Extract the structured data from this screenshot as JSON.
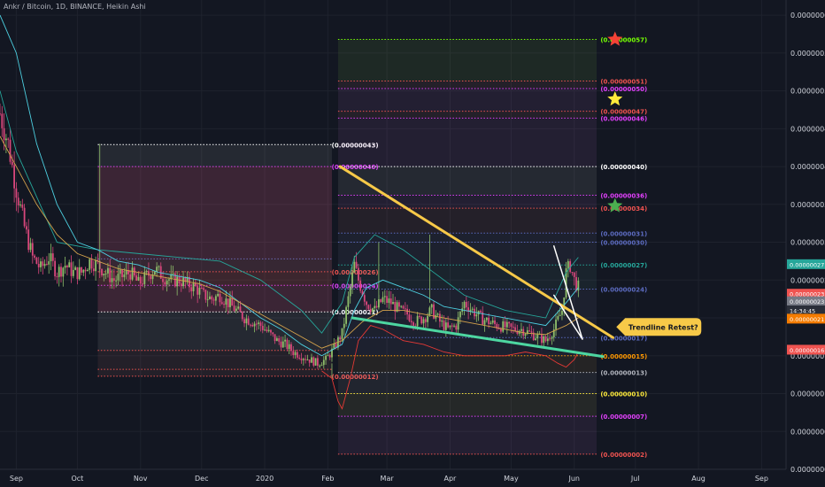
{
  "chart_data": {
    "type": "candlestick",
    "title": "Ankr / Bitcoin, 1D, BINANCE, Heikin Ashi",
    "x_ticks": [
      "Sep",
      "Oct",
      "Nov",
      "Dec",
      "2020",
      "Feb",
      "Mar",
      "Apr",
      "May",
      "Jun",
      "Jul",
      "Aug",
      "Sep"
    ],
    "y_ticks": [
      "0.00000060",
      "0.00000055",
      "0.00000050",
      "0.00000045",
      "0.00000040",
      "0.00000035",
      "0.00000030",
      "0.00000025",
      "0.00000020",
      "0.00000015",
      "0.00000010",
      "0.00000005",
      "0.00000000"
    ],
    "y_tick_values": [
      60,
      55,
      50,
      45,
      40,
      35,
      30,
      25,
      20,
      15,
      10,
      5,
      0
    ],
    "ylim": [
      0,
      62
    ],
    "x_tick_days": [
      0,
      30,
      61,
      91,
      122,
      153,
      182,
      213,
      243,
      274,
      304,
      335,
      366
    ],
    "xlim": [
      -8,
      378
    ],
    "price_tags": [
      {
        "label": "0.00000027",
        "value": 27.1,
        "color": "#26a69a"
      },
      {
        "label": "0.00000023",
        "value": 23.2,
        "color": "#ef5350"
      },
      {
        "label": "0.00000023",
        "value": 22.2,
        "color": "#787b86"
      },
      {
        "label": "14:34:45",
        "value": 21.0,
        "color": "#2a2e39"
      },
      {
        "label": "0.00000021",
        "value": 19.9,
        "color": "#f57c00"
      },
      {
        "label": "0.00000016",
        "value": 15.8,
        "color": "#ef5350"
      }
    ],
    "fib_left": {
      "day_start": 40,
      "day_end": 155,
      "label_day": 154,
      "levels": [
        {
          "label": "(0.00000043)",
          "value": 42.9,
          "color": "#ffffff",
          "show": true
        },
        {
          "label": "(0.00000040)",
          "value": 40.0,
          "color": "#e040fb",
          "show": true
        },
        {
          "label": "(0.00000028)",
          "value": 27.8,
          "color": "#5c6bc0",
          "show": false
        },
        {
          "label": "(0.00000026)",
          "value": 26.1,
          "color": "#ef5350",
          "show": true
        },
        {
          "label": "(0.00000024)",
          "value": 24.3,
          "color": "#e040fb",
          "show": true
        },
        {
          "label": "(0.00000021)",
          "value": 20.8,
          "color": "#ffffff",
          "show": true
        },
        {
          "label": "(0.00000015)",
          "value": 15.7,
          "color": "#ef5350",
          "show": false
        },
        {
          "label": "(0.00000013)",
          "value": 13.2,
          "color": "#ef5350",
          "show": false
        },
        {
          "label": "(0.00000012)",
          "value": 12.3,
          "color": "#ef5350",
          "show": true
        }
      ]
    },
    "fib_right": {
      "day_start": 158,
      "day_end": 285,
      "label_day": 286,
      "levels": [
        {
          "label": "(0.00000057)",
          "value": 56.8,
          "color": "#76ff03",
          "show": true
        },
        {
          "label": "(0.00000051)",
          "value": 51.3,
          "color": "#ef5350",
          "show": true
        },
        {
          "label": "(0.00000050)",
          "value": 50.3,
          "color": "#e040fb",
          "show": true
        },
        {
          "label": "(0.00000047)",
          "value": 47.3,
          "color": "#ef5350",
          "show": true
        },
        {
          "label": "(0.00000046)",
          "value": 46.4,
          "color": "#e040fb",
          "show": true
        },
        {
          "label": "(0.00000040)",
          "value": 40.0,
          "color": "#ffffff",
          "show": true
        },
        {
          "label": "(0.00000036)",
          "value": 36.2,
          "color": "#e040fb",
          "show": true
        },
        {
          "label": "(0.00000034)",
          "value": 34.5,
          "color": "#ef5350",
          "show": true
        },
        {
          "label": "(0.00000031)",
          "value": 31.2,
          "color": "#5c6bc0",
          "show": true
        },
        {
          "label": "(0.00000030)",
          "value": 30.0,
          "color": "#5c6bc0",
          "show": true
        },
        {
          "label": "(0.00000027)",
          "value": 27.0,
          "color": "#26a69a",
          "show": true
        },
        {
          "label": "(0.00000024)",
          "value": 23.8,
          "color": "#5c6bc0",
          "show": true
        },
        {
          "label": "(0.00000017)",
          "value": 17.4,
          "color": "#5c6bc0",
          "show": true
        },
        {
          "label": "(0.00000015)",
          "value": 15.0,
          "color": "#ff9800",
          "show": true
        },
        {
          "label": "(0.00000013)",
          "value": 12.8,
          "color": "#b2b5be",
          "show": true
        },
        {
          "label": "(0.00000010)",
          "value": 10.0,
          "color": "#ffeb3b",
          "show": true
        },
        {
          "label": "(0.00000007)",
          "value": 7.0,
          "color": "#e040fb",
          "show": true
        },
        {
          "label": "(0.00000002)",
          "value": 2.0,
          "color": "#ef5350",
          "show": true
        }
      ]
    },
    "trendlines": [
      {
        "name": "descending-resistance",
        "color": "#f7c948",
        "x1": 159,
        "y1": 40.0,
        "x2": 293,
        "y2": 17.4
      },
      {
        "name": "ascending-support",
        "color": "#4dd6a1",
        "x1": 165,
        "y1": 20.0,
        "x2": 288,
        "y2": 14.9
      },
      {
        "name": "wedge-upper",
        "color": "#ffffff",
        "x1": 264,
        "y1": 29.5,
        "x2": 278,
        "y2": 17.2
      },
      {
        "name": "wedge-lower",
        "color": "#ffffff",
        "x1": 264,
        "y1": 23.0,
        "x2": 278,
        "y2": 17.2
      }
    ],
    "stars": [
      {
        "name": "red-star",
        "color": "#f44336",
        "day": 294,
        "value": 56.8
      },
      {
        "name": "yellow-star",
        "color": "#ffeb3b",
        "day": 294,
        "value": 48.9
      },
      {
        "name": "green-star",
        "color": "#4caf50",
        "day": 294,
        "value": 34.8
      }
    ],
    "callout": {
      "text": "Trendline Retest?",
      "day": 299,
      "value": 18.8
    },
    "keypoints": [
      [
        -8,
        47
      ],
      [
        -4,
        43
      ],
      [
        0,
        37
      ],
      [
        4,
        32
      ],
      [
        8,
        28
      ],
      [
        12,
        26.5
      ],
      [
        16,
        28
      ],
      [
        20,
        26
      ],
      [
        24,
        27
      ],
      [
        28,
        26
      ],
      [
        32,
        26
      ],
      [
        36,
        27.5
      ],
      [
        40,
        27
      ],
      [
        44,
        26
      ],
      [
        48,
        25
      ],
      [
        52,
        25.5
      ],
      [
        56,
        26
      ],
      [
        60,
        24.5
      ],
      [
        64,
        25.5
      ],
      [
        68,
        26.5
      ],
      [
        72,
        25.5
      ],
      [
        76,
        25
      ],
      [
        80,
        25
      ],
      [
        84,
        24.5
      ],
      [
        88,
        24
      ],
      [
        92,
        23
      ],
      [
        96,
        22.5
      ],
      [
        100,
        23
      ],
      [
        104,
        22
      ],
      [
        108,
        21
      ],
      [
        112,
        20
      ],
      [
        116,
        19.5
      ],
      [
        120,
        19
      ],
      [
        124,
        18
      ],
      [
        128,
        17
      ],
      [
        132,
        16.5
      ],
      [
        136,
        15.5
      ],
      [
        140,
        15
      ],
      [
        144,
        14.5
      ],
      [
        148,
        14
      ],
      [
        152,
        14.5
      ],
      [
        156,
        16
      ],
      [
        160,
        18
      ],
      [
        164,
        24
      ],
      [
        166,
        27
      ],
      [
        168,
        25
      ],
      [
        172,
        22
      ],
      [
        176,
        21
      ],
      [
        180,
        22.5
      ],
      [
        184,
        22
      ],
      [
        188,
        21
      ],
      [
        192,
        20.5
      ],
      [
        196,
        19.5
      ],
      [
        200,
        20
      ],
      [
        204,
        21
      ],
      [
        208,
        19.5
      ],
      [
        212,
        18.5
      ],
      [
        216,
        19
      ],
      [
        220,
        22
      ],
      [
        224,
        21
      ],
      [
        228,
        20
      ],
      [
        232,
        19.5
      ],
      [
        236,
        19
      ],
      [
        240,
        18.8
      ],
      [
        244,
        18.5
      ],
      [
        248,
        18.5
      ],
      [
        252,
        18
      ],
      [
        256,
        17.5
      ],
      [
        260,
        17
      ],
      [
        264,
        18.5
      ],
      [
        268,
        21
      ],
      [
        270,
        26
      ],
      [
        272,
        27
      ],
      [
        274,
        25
      ],
      [
        276,
        24
      ]
    ],
    "ma_teal": [
      [
        -8,
        60
      ],
      [
        0,
        55
      ],
      [
        10,
        43
      ],
      [
        20,
        35
      ],
      [
        30,
        30
      ],
      [
        40,
        29
      ],
      [
        50,
        27.5
      ],
      [
        60,
        27
      ],
      [
        70,
        26
      ],
      [
        80,
        25.5
      ],
      [
        90,
        25
      ],
      [
        100,
        24
      ],
      [
        110,
        22
      ],
      [
        120,
        20
      ],
      [
        130,
        18.5
      ],
      [
        140,
        16.5
      ],
      [
        150,
        15
      ],
      [
        160,
        16.5
      ],
      [
        166,
        21
      ],
      [
        172,
        24
      ],
      [
        180,
        25
      ],
      [
        190,
        24
      ],
      [
        200,
        23
      ],
      [
        210,
        21.5
      ],
      [
        220,
        21
      ],
      [
        230,
        20.5
      ],
      [
        240,
        20
      ],
      [
        250,
        19.5
      ],
      [
        260,
        19
      ],
      [
        270,
        22
      ],
      [
        276,
        24
      ]
    ],
    "ma_orange": [
      [
        -8,
        44
      ],
      [
        0,
        40
      ],
      [
        10,
        35
      ],
      [
        20,
        31
      ],
      [
        30,
        28.5
      ],
      [
        40,
        27.5
      ],
      [
        50,
        26.5
      ],
      [
        60,
        26
      ],
      [
        70,
        25.5
      ],
      [
        80,
        25
      ],
      [
        90,
        24.5
      ],
      [
        100,
        23.5
      ],
      [
        110,
        22
      ],
      [
        120,
        20.5
      ],
      [
        130,
        19
      ],
      [
        140,
        17.5
      ],
      [
        150,
        16
      ],
      [
        160,
        17
      ],
      [
        170,
        19.5
      ],
      [
        180,
        21
      ],
      [
        190,
        21
      ],
      [
        200,
        20.5
      ],
      [
        210,
        20
      ],
      [
        220,
        19.5
      ],
      [
        230,
        19
      ],
      [
        240,
        18.5
      ],
      [
        250,
        18
      ],
      [
        260,
        17.8
      ],
      [
        270,
        19
      ],
      [
        276,
        20
      ]
    ],
    "bb_lower_red": [
      [
        150,
        13
      ],
      [
        155,
        12
      ],
      [
        158,
        9
      ],
      [
        160,
        8
      ],
      [
        164,
        12
      ],
      [
        168,
        17
      ],
      [
        174,
        19
      ],
      [
        180,
        18.5
      ],
      [
        190,
        17
      ],
      [
        200,
        16.5
      ],
      [
        210,
        15.5
      ],
      [
        220,
        15
      ],
      [
        230,
        15
      ],
      [
        240,
        15
      ],
      [
        250,
        15.5
      ],
      [
        260,
        15
      ],
      [
        266,
        14
      ],
      [
        270,
        13.5
      ],
      [
        274,
        14.5
      ],
      [
        276,
        15.5
      ]
    ],
    "bb_upper_teal2": [
      [
        -8,
        50
      ],
      [
        0,
        42
      ],
      [
        20,
        30
      ],
      [
        40,
        29
      ],
      [
        60,
        28.5
      ],
      [
        80,
        28
      ],
      [
        100,
        27.5
      ],
      [
        120,
        25
      ],
      [
        140,
        21
      ],
      [
        150,
        18
      ],
      [
        160,
        22
      ],
      [
        166,
        28
      ],
      [
        176,
        31
      ],
      [
        190,
        29
      ],
      [
        200,
        27
      ],
      [
        220,
        23
      ],
      [
        240,
        21
      ],
      [
        260,
        20
      ],
      [
        270,
        26
      ],
      [
        276,
        28
      ]
    ]
  }
}
